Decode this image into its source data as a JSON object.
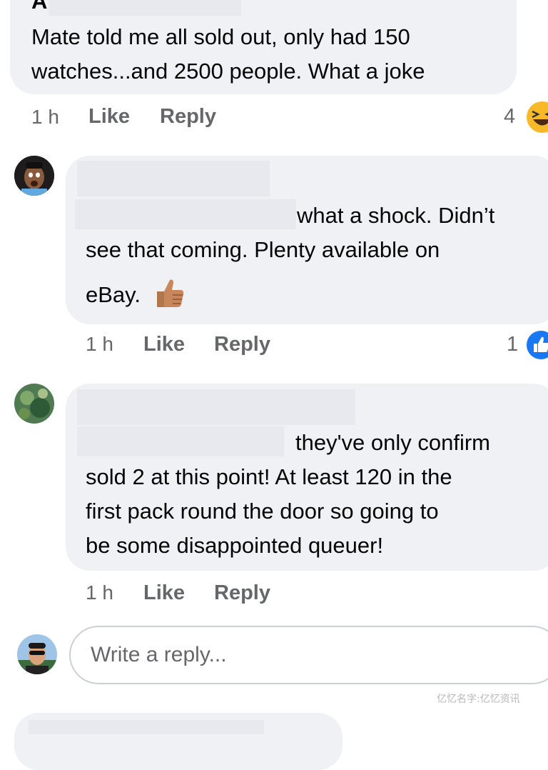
{
  "comments": [
    {
      "author_initial": "A",
      "lines": [
        "Mate told me all sold out, only had 150",
        "watches...and 2500 people. What a joke"
      ],
      "time": "1 h",
      "like_label": "Like",
      "reply_label": "Reply",
      "reaction_count": "4",
      "reaction_icon": "haha-emoji-icon"
    },
    {
      "lines": [
        "what a shock. Didn’t",
        "see that coming. Plenty available on",
        "eBay."
      ],
      "time": "1 h",
      "like_label": "Like",
      "reply_label": "Reply",
      "reaction_count": "1",
      "reaction_icon": "like-icon"
    },
    {
      "lines": [
        "they've only confirm",
        "sold 2 at this point! At least 120 in the",
        "first pack round the door so going to",
        "be some disappointed queuer!"
      ],
      "time": "1 h",
      "like_label": "Like",
      "reply_label": "Reply"
    }
  ],
  "reply_input": {
    "placeholder": "Write a reply..."
  },
  "watermark": "亿忆名字:亿忆资讯",
  "colors": {
    "bubble": "#eff1f5",
    "meta": "#65676b",
    "like_blue": "#1877f2",
    "haha_yellow": "#f7b928"
  }
}
